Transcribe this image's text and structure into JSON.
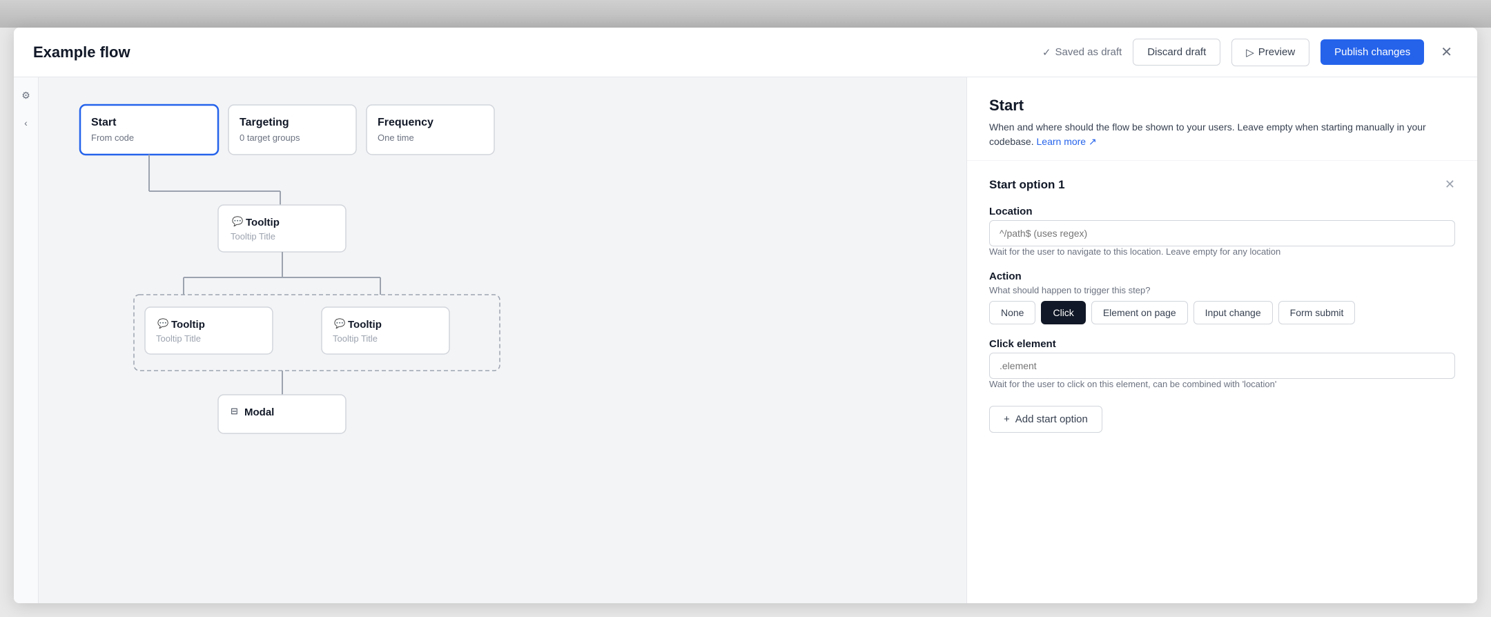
{
  "header": {
    "title": "Example flow",
    "saved_label": "Saved as draft",
    "discard_label": "Discard draft",
    "preview_label": "Preview",
    "publish_label": "Publish changes"
  },
  "flow_nodes": {
    "start": {
      "title": "Start",
      "subtitle": "From code"
    },
    "targeting": {
      "title": "Targeting",
      "subtitle": "0 target groups"
    },
    "frequency": {
      "title": "Frequency",
      "subtitle": "One time"
    },
    "tooltip1": {
      "icon": "💬",
      "title": "Tooltip",
      "subtitle": "Tooltip Title"
    },
    "tooltip2": {
      "icon": "💬",
      "title": "Tooltip",
      "subtitle": "Tooltip Title"
    },
    "tooltip3": {
      "icon": "💬",
      "title": "Tooltip",
      "subtitle": "Tooltip Title"
    },
    "modal": {
      "icon": "⊟",
      "title": "Modal"
    }
  },
  "right_panel": {
    "title": "Start",
    "description": "When and where should the flow be shown to your users. Leave empty when starting manually in your codebase.",
    "learn_more": "Learn more ↗",
    "start_option": {
      "title": "Start option 1",
      "location_label": "Location",
      "location_placeholder": "^/path$ (uses regex)",
      "location_hint": "Wait for the user to navigate to this location. Leave empty for any location",
      "action_label": "Action",
      "action_hint": "What should happen to trigger this step?",
      "action_buttons": [
        {
          "label": "None",
          "active": false
        },
        {
          "label": "Click",
          "active": true
        },
        {
          "label": "Element on page",
          "active": false
        },
        {
          "label": "Input change",
          "active": false
        },
        {
          "label": "Form submit",
          "active": false
        }
      ],
      "click_element_label": "Click element",
      "click_element_placeholder": ".element",
      "click_element_hint": "Wait for the user to click on this element, can be combined with 'location'"
    },
    "add_start_option_label": "Add start option"
  }
}
